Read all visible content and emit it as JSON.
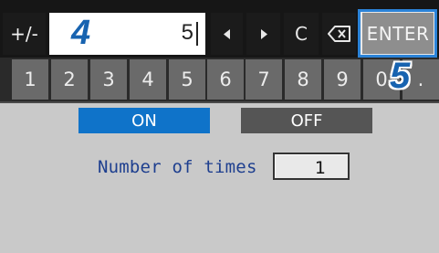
{
  "keypad": {
    "plus_minus": "+/-",
    "display_value": "5",
    "clear_label": "C",
    "enter_label": "ENTER",
    "digits": [
      "1",
      "2",
      "3",
      "4",
      "5",
      "6",
      "7",
      "8",
      "9",
      "0",
      "."
    ]
  },
  "callouts": {
    "step4": "4",
    "step5": "5"
  },
  "toggle": {
    "on_label": "ON",
    "off_label": "OFF",
    "selected": "ON"
  },
  "setting": {
    "label": "Number of times",
    "value": "1"
  },
  "colors": {
    "accent": "#0f73c9",
    "callout": "#1763b0",
    "enter_highlight": "#2b83d8"
  },
  "icons": {
    "left": "arrow-left-icon",
    "right": "arrow-right-icon",
    "backspace": "backspace-icon"
  }
}
